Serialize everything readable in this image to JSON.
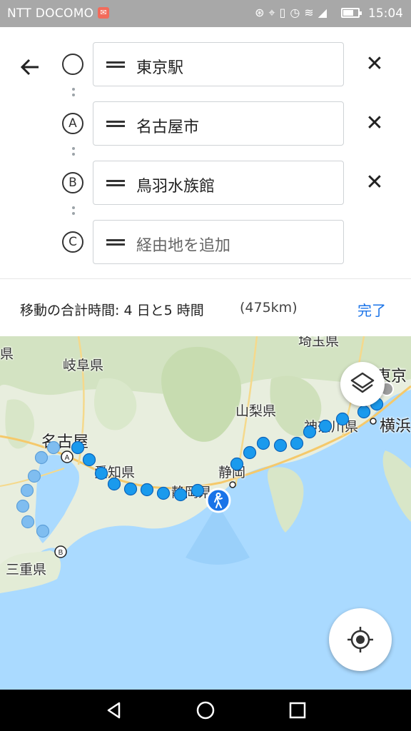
{
  "status_bar": {
    "carrier": "NTT DOCOMO",
    "time": "15:04",
    "battery_level": 0.72,
    "icons": [
      "nfc-icon",
      "location-icon",
      "vibrate-icon",
      "alarm-icon",
      "wifi-icon",
      "signal-4g-icon"
    ]
  },
  "directions": {
    "waypoints": [
      {
        "marker": "",
        "value": "東京駅",
        "placeholder": ""
      },
      {
        "marker": "A",
        "value": "名古屋市",
        "placeholder": ""
      },
      {
        "marker": "B",
        "value": "鳥羽水族館",
        "placeholder": ""
      },
      {
        "marker": "C",
        "value": "",
        "placeholder": "経由地を追加"
      }
    ]
  },
  "summary": {
    "total_time": "移動の合計時間: 4 日と5 時間",
    "distance": "(475km)",
    "done_label": "完了"
  },
  "map": {
    "labels": [
      "岐阜県",
      "名古屋",
      "愛知県",
      "三重県",
      "静岡県",
      "静岡",
      "山梨県",
      "神奈川県",
      "横浜",
      "東京",
      "埼玉県",
      "県"
    ],
    "route_color": "#1a9aed",
    "water_color": "#aadaff"
  },
  "colors": {
    "accent": "#1a73e8",
    "route_dot": "#1a9aed",
    "route_dot_faded": "#7fbdf0"
  }
}
